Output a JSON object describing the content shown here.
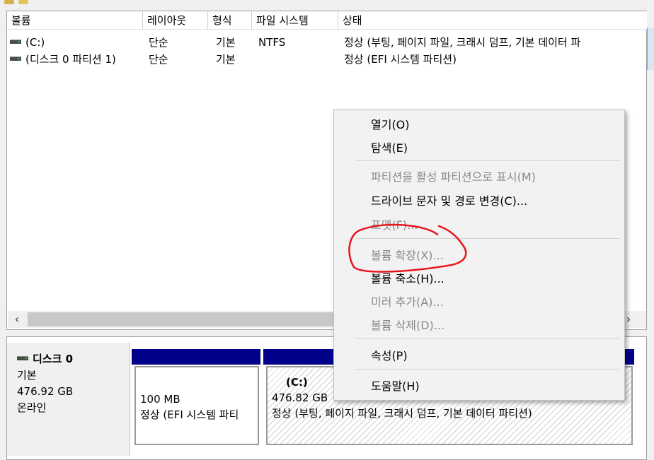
{
  "top_icons": [
    {
      "name": "toolbar-icon-1",
      "color": "#d8b04a"
    },
    {
      "name": "toolbar-icon-2",
      "color": "#e2c25c"
    }
  ],
  "volume_list": {
    "columns": [
      "볼륨",
      "레이아웃",
      "형식",
      "파일 시스템",
      "상태"
    ],
    "rows": [
      {
        "icon": "drive-icon",
        "volume": "(C:)",
        "layout": "단순",
        "type": "기본",
        "fs": "NTFS",
        "status": "정상 (부팅, 페이지 파일, 크래시 덤프, 기본 데이터 파"
      },
      {
        "icon": "drive-icon",
        "volume": "(디스크 0 파티션 1)",
        "layout": "단순",
        "type": "기본",
        "fs": "",
        "status": "정상 (EFI 시스템 파티션)"
      }
    ],
    "scroll_left": "‹",
    "scroll_right": "›"
  },
  "disk": {
    "icon": "drive-icon",
    "name": "디스크 0",
    "kind": "기본",
    "size": "476.92 GB",
    "state": "온라인",
    "partitions": [
      {
        "name": "",
        "size": "100 MB",
        "status": "정상 (EFI 시스템 파티"
      },
      {
        "name": "(C:)",
        "size": "476.82 GB",
        "status": "정상 (부팅, 페이지 파일, 크래시 덤프, 기본 데이터 파티션)"
      }
    ],
    "partition_bar_color": "#00008b"
  },
  "context_menu": {
    "items": [
      {
        "label": "열기(O)",
        "enabled": true
      },
      {
        "label": "탐색(E)",
        "enabled": true
      },
      {
        "label": "파티션을 활성 파티션으로 표시(M)",
        "enabled": false
      },
      {
        "label": "드라이브 문자 및 경로 변경(C)...",
        "enabled": true
      },
      {
        "label": "포맷(F)...",
        "enabled": false
      },
      {
        "label": "볼륨 확장(X)...",
        "enabled": false
      },
      {
        "label": "볼륨 축소(H)...",
        "enabled": true
      },
      {
        "label": "미러 추가(A)...",
        "enabled": false
      },
      {
        "label": "볼륨 삭제(D)...",
        "enabled": false
      },
      {
        "label": "속성(P)",
        "enabled": true
      },
      {
        "label": "도움말(H)",
        "enabled": true
      }
    ]
  },
  "annotation": {
    "shape": "hand-drawn-circle",
    "color": "#e8141c",
    "target": "볼륨 확장(X)..."
  }
}
